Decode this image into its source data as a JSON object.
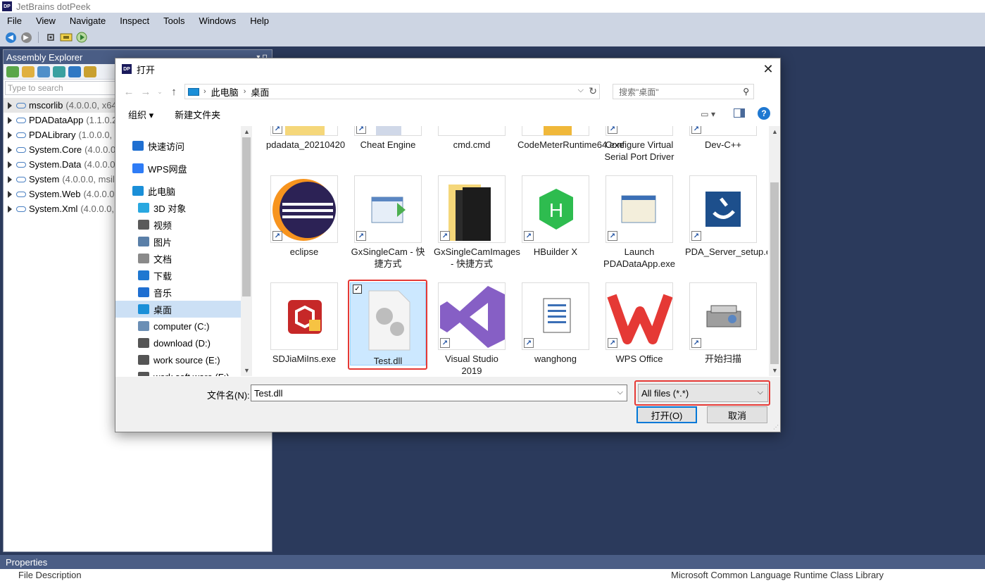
{
  "app": {
    "title": "JetBrains dotPeek",
    "logo_text": "DP",
    "menu": [
      "File",
      "View",
      "Navigate",
      "Inspect",
      "Tools",
      "Windows",
      "Help"
    ]
  },
  "assembly_explorer": {
    "title": "Assembly Explorer",
    "pin": "▾ ⊓",
    "search_placeholder": "Type to search",
    "items": [
      {
        "name": "mscorlib",
        "version": "(4.0.0.0, x64"
      },
      {
        "name": "PDADataApp",
        "version": "(1.1.0.2"
      },
      {
        "name": "PDALibrary",
        "version": "(1.0.0.0, r"
      },
      {
        "name": "System.Core",
        "version": "(4.0.0.0,"
      },
      {
        "name": "System.Data",
        "version": "(4.0.0.0,"
      },
      {
        "name": "System",
        "version": "(4.0.0.0, msil,"
      },
      {
        "name": "System.Web",
        "version": "(4.0.0.0,"
      },
      {
        "name": "System.Xml",
        "version": "(4.0.0.0,"
      }
    ]
  },
  "properties": {
    "title": "Properties",
    "key": "File Description",
    "value": "Microsoft Common Language Runtime Class Library"
  },
  "dialog": {
    "title": "打开",
    "close": "✕",
    "breadcrumb": [
      "此电脑",
      "桌面"
    ],
    "search_placeholder": "搜索\"桌面\"",
    "organize": "组织 ▾",
    "new_folder": "新建文件夹",
    "help": "?",
    "nav": [
      {
        "label": "快速访问",
        "icon": "star-icon",
        "color": "#1f6fd1",
        "indent": 24
      },
      {
        "label": "WPS网盘",
        "icon": "cloud-icon",
        "color": "#2e7cf6",
        "indent": 24
      },
      {
        "label": "此电脑",
        "icon": "computer-icon",
        "color": "#1a8fd8",
        "indent": 24
      },
      {
        "label": "3D 对象",
        "icon": "cube-icon",
        "color": "#29a8e0",
        "indent": 32
      },
      {
        "label": "视频",
        "icon": "video-icon",
        "color": "#5a5a5a",
        "indent": 32
      },
      {
        "label": "图片",
        "icon": "picture-icon",
        "color": "#5a7fa8",
        "indent": 32
      },
      {
        "label": "文档",
        "icon": "document-icon",
        "color": "#8a8a8a",
        "indent": 32
      },
      {
        "label": "下载",
        "icon": "download-icon",
        "color": "#1f78d1",
        "indent": 32
      },
      {
        "label": "音乐",
        "icon": "music-icon",
        "color": "#1f6fd1",
        "indent": 32
      },
      {
        "label": "桌面",
        "icon": "desktop-icon",
        "color": "#1a8fd8",
        "indent": 32
      },
      {
        "label": "computer (C:)",
        "icon": "drive-icon",
        "color": "#6b8fb5",
        "indent": 32
      },
      {
        "label": "download (D:)",
        "icon": "drive-icon",
        "color": "#555555",
        "indent": 32
      },
      {
        "label": "work source (E:)",
        "icon": "drive-icon",
        "color": "#555555",
        "indent": 32
      },
      {
        "label": "work soft ware (F:)",
        "icon": "drive-icon",
        "color": "#555555",
        "indent": 32
      }
    ],
    "files_row1": [
      "pdadata_20210420",
      "Cheat Engine",
      "cmd.cmd",
      "CodeMeterRuntime64.exe",
      "Configure Virtual Serial Port Driver",
      "Dev-C++"
    ],
    "files_row2": [
      "eclipse",
      "GxSingleCam - 快捷方式",
      "GxSingleCamImages - 快捷方式",
      "HBuilder X",
      "Launch PDADataApp.exe",
      "PDA_Server_setup.exe"
    ],
    "files_row3": [
      "SDJiaMiIns.exe",
      "Test.dll",
      "Visual Studio 2019",
      "wanghong",
      "WPS Office",
      "开始扫描"
    ],
    "filename_label": "文件名(N):",
    "filename_value": "Test.dll",
    "filetype_value": "All files (*.*)",
    "open_button": "打开(O)",
    "cancel_button": "取消",
    "colors": {
      "accent": "#0078d7",
      "highlight": "#e53935",
      "selection": "#cce8ff"
    }
  }
}
